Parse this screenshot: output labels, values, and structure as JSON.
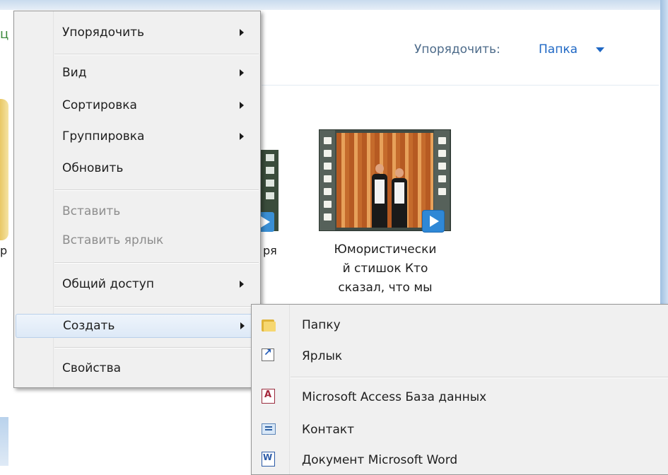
{
  "explorer": {
    "arrange_label": "Упорядочить:",
    "arrange_value": "Папка",
    "left_fragment_char": "ц",
    "left_fragment_text": "р",
    "video_fragment_text": "ря",
    "video_caption": [
      "Юмористически",
      "й стишок Кто",
      "сказал, что мы"
    ]
  },
  "context_menu": {
    "items": [
      {
        "label": "Упорядочить"
      },
      {
        "label": "Вид"
      },
      {
        "label": "Сортировка"
      },
      {
        "label": "Группировка"
      },
      {
        "label": "Обновить"
      },
      {
        "label": "Вставить"
      },
      {
        "label": "Вставить ярлык"
      },
      {
        "label": "Общий доступ"
      },
      {
        "label": "Создать"
      },
      {
        "label": "Свойства"
      }
    ]
  },
  "submenu": {
    "items": [
      {
        "label": "Папку",
        "icon": "folder-icon"
      },
      {
        "label": "Ярлык",
        "icon": "shortcut-icon"
      },
      {
        "label": "Microsoft Access База данных",
        "icon": "access-database-icon"
      },
      {
        "label": "Контакт",
        "icon": "contact-icon"
      },
      {
        "label": "Документ Microsoft Word",
        "icon": "word-document-icon"
      }
    ]
  },
  "colors": {
    "menu_background": "#f0f0f0",
    "link_blue": "#1e67c4",
    "hover_highlight": "#dde9f7",
    "disabled_text": "#8d8d8d"
  }
}
